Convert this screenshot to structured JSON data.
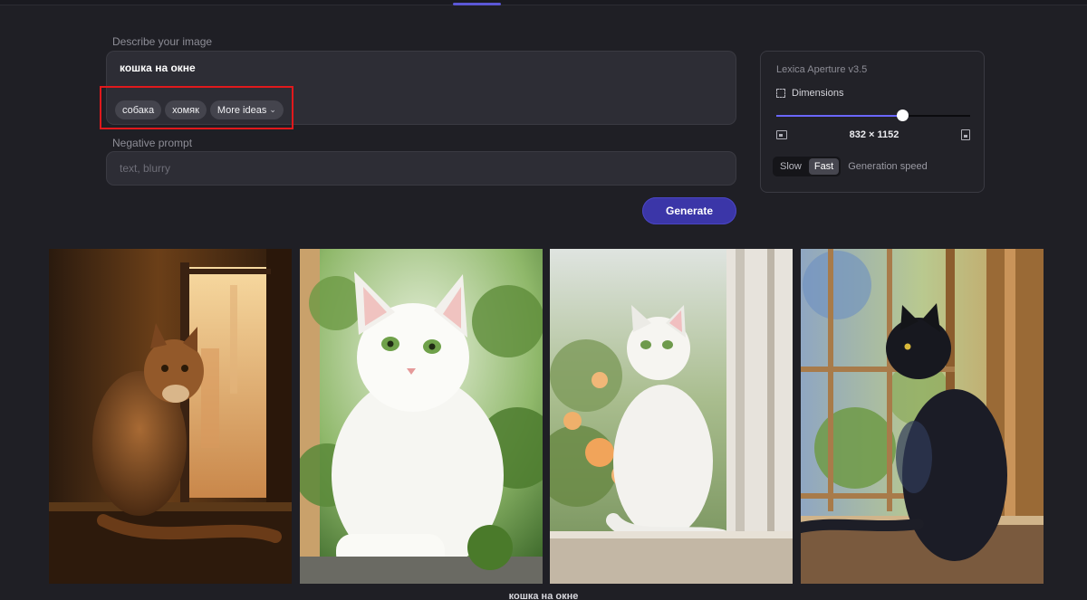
{
  "prompt": {
    "label": "Describe your image",
    "value": "кошка на окне",
    "suggestions": [
      "собака",
      "хомяк"
    ],
    "more_ideas_label": "More ideas"
  },
  "negative_prompt": {
    "label": "Negative prompt",
    "placeholder": "text, blurry"
  },
  "generate_label": "Generate",
  "settings": {
    "model": "Lexica Aperture v3.5",
    "dimensions_label": "Dimensions",
    "dimensions_value": "832 × 1152",
    "slider_fraction": 0.65,
    "speed_options": [
      "Slow",
      "Fast"
    ],
    "speed_selected": "Fast",
    "speed_label": "Generation speed"
  },
  "gallery": {
    "caption": "кошка на окне",
    "images": [
      {
        "icon": "tabby-cat-window-image"
      },
      {
        "icon": "white-cat-garden-image"
      },
      {
        "icon": "white-cat-roses-image"
      },
      {
        "icon": "black-cat-window-image"
      }
    ]
  },
  "colors": {
    "background": "#1f1f25",
    "accent": "#3b36a8",
    "slider": "#6a66ff",
    "highlight": "#e0191c"
  }
}
